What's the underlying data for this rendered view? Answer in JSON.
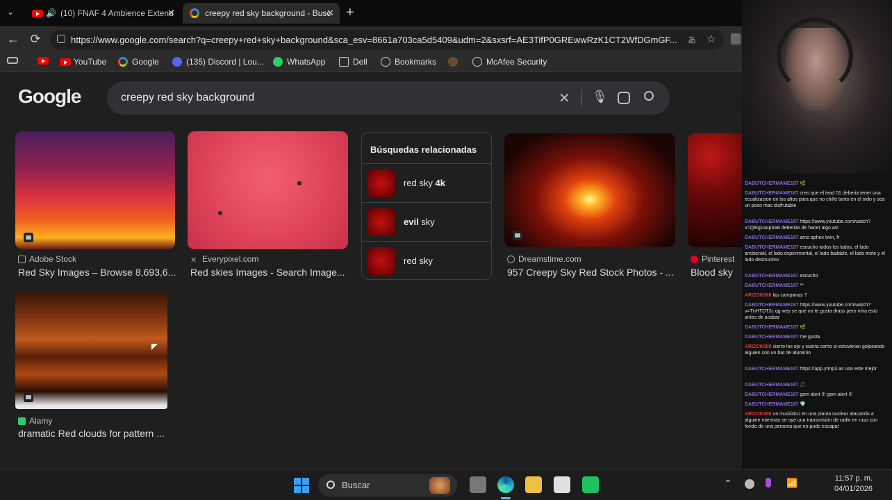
{
  "browser": {
    "tabs": [
      {
        "label": "(10) FNAF 4 Ambience Extend",
        "active": false
      },
      {
        "label": "creepy red sky background - Busc",
        "active": true
      }
    ],
    "url": "https://www.google.com/search?q=creepy+red+sky+background&sca_esv=8661a703ca5d5409&udm=2&sxsrf=AE3TifP0GREwwRzK1CT2WfDGmGF...",
    "bookmarks": [
      "YouTube",
      "Google",
      "(135) Discord | Lou...",
      "WhatsApp",
      "Dell",
      "Bookmarks",
      "McAfee Security"
    ]
  },
  "google": {
    "logo": "Google",
    "query": "creepy red sky background",
    "results": [
      {
        "source": "Adobe Stock",
        "title": "Red Sky Images – Browse 8,693,6..."
      },
      {
        "source": "Everypixel.com",
        "title": "Red skies Images - Search Image..."
      },
      {
        "source": "Dreamstime.com",
        "title": "957 Creepy Sky Red Stock Photos - ..."
      },
      {
        "source": "Pinterest",
        "title": "Blood sky"
      },
      {
        "source": "Alamy",
        "title": "dramatic Red clouds for pattern ..."
      }
    ],
    "related": {
      "heading": "Búsquedas relacionadas",
      "items": [
        {
          "plain": "red sky ",
          "bold": "4k",
          "bold_first": false
        },
        {
          "plain": " sky",
          "bold": "evil",
          "bold_first": true
        },
        {
          "plain": "red sky",
          "bold": "",
          "bold_first": false
        }
      ]
    }
  },
  "chat": [
    {
      "user": "DABUTCHERMAME187",
      "msg": "🌿",
      "color": "purple"
    },
    {
      "user": "DABUTCHERMAME187",
      "msg": "creo que el lead 01 deberia tener una ecualizacion en los altos para que no chille tanto en el oido y sea un poco mas disfrutable",
      "color": "purple"
    },
    {
      "user": "DABUTCHERMAME187",
      "msg": "https://www.youtube.com/watch?v=Q8Ig1aopSa8 deberias de hacer algo asi",
      "color": "purple"
    },
    {
      "user": "DABUTCHERMAME187",
      "msg": "amo aphex twin, fr",
      "color": "purple"
    },
    {
      "user": "DABUTCHERMAME187",
      "msg": "escucho todos los lados, el lado ambiental, el lado experimental, el lado bailable, el lado triste y el lado destructivo",
      "color": "purple"
    },
    {
      "user": "DABUTCHERMAME187",
      "msg": "escucho",
      "color": "purple"
    },
    {
      "user": "DABUTCHERMAME187",
      "msg": "**",
      "color": "purple"
    },
    {
      "user": "ARIZOKIIIIII",
      "msg": "las campanas ?",
      "color": "red"
    },
    {
      "user": "DABUTCHERMAME187",
      "msg": "https://www.youtube.com/watch?v=TnHTDT2c qg wey se que no te gusta drass pero mira esto antes de acabar",
      "color": "purple"
    },
    {
      "user": "DABUTCHERMAME187",
      "msg": "🌿",
      "color": "purple"
    },
    {
      "user": "DABUTCHERMAME187",
      "msg": "me gusta",
      "color": "purple"
    },
    {
      "user": "ARIZOKIIIIII",
      "msg": "cierro los ojo y suena como si estuvieran golpeando alguien con un bat de aluminio",
      "color": "red"
    },
    {
      "user": "DABUTCHERMAME187",
      "msg": "https://app.ytmp3.as usa este mejor",
      "color": "purple"
    },
    {
      "user": "DABUTCHERMAME187",
      "msg": "🎵",
      "color": "purple"
    },
    {
      "user": "DABUTCHERMAME187",
      "msg": "gem alert !!! gem alert !!!",
      "color": "purple"
    },
    {
      "user": "DABUTCHERMAME187",
      "msg": "💎",
      "color": "purple"
    },
    {
      "user": "ARIZOKIIIIII",
      "msg": "un musiútico en una planta nuclear atacando a alguien mientras se oye una transmisión de radio en ruso con fondo de una persona que no pudo escapar",
      "color": "red"
    }
  ],
  "taskbar": {
    "search_placeholder": "Buscar",
    "time": "11:57 p. m.",
    "date": "04/01/2026"
  },
  "colors": {
    "page_bg": "#1f1f1f",
    "accent": "#8ab4f8"
  }
}
